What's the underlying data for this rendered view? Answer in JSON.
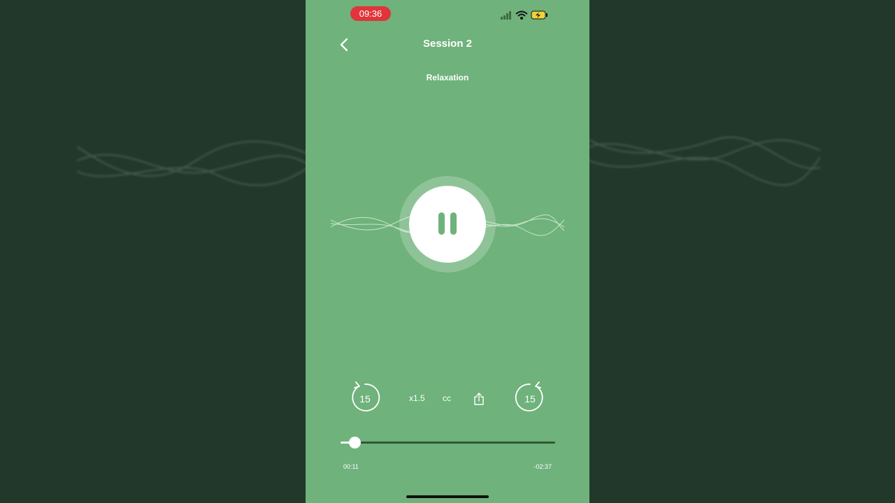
{
  "status_bar": {
    "time": "09:36",
    "icons": [
      "cellular-signal-icon",
      "wifi-icon",
      "battery-charging-icon"
    ]
  },
  "header": {
    "back_icon": "chevron-left-icon",
    "title": "Session 2",
    "subtitle": "Relaxation"
  },
  "player": {
    "state_icon": "pause-icon",
    "skip_back_label": "15",
    "skip_forward_label": "15",
    "speed_label": "x1.5",
    "captions_label": "cc",
    "share_icon": "share-icon",
    "progress_fraction": 0.065,
    "elapsed": "00:11",
    "remaining": "-02:37"
  },
  "colors": {
    "background": "#6fb27b",
    "backdrop": "#21382a",
    "status_pill": "#e0353a",
    "track": "#2f5a38"
  }
}
